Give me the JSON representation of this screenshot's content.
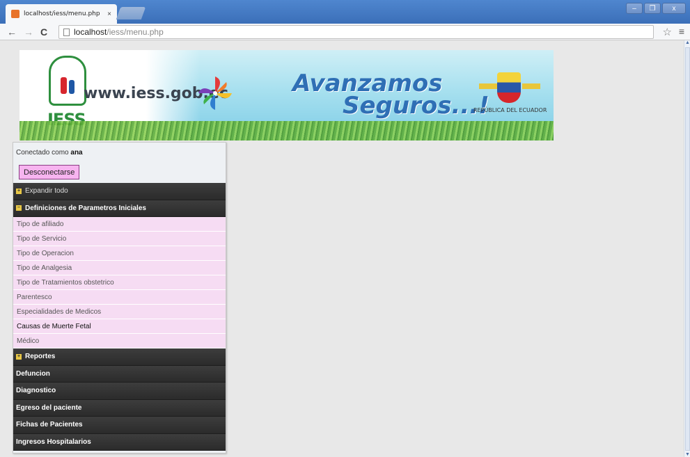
{
  "browser": {
    "tab_title": "localhost/iess/menu.php",
    "tab_close": "×",
    "url_host": "localhost",
    "url_path": "/iess/menu.php",
    "back": "←",
    "forward": "→",
    "reload": "C",
    "star": "☆",
    "menu": "≡",
    "minimize": "–",
    "maximize": "❐",
    "close": "x"
  },
  "banner": {
    "site": "www.iess.gob.ec",
    "logo_text": "IESS",
    "slogan_line1": "Avanzamos",
    "slogan_line2": "Seguros...!",
    "country": "REPÚBLICA DEL ECUADOR"
  },
  "session": {
    "connected_prefix": "Conectado como ",
    "user": "ana",
    "logout_label": "Desconectarse"
  },
  "menu": {
    "expand_all": "Expandir todo",
    "open_section": "Definiciones de Parametros Iniciales",
    "items": [
      "Tipo de afiliado",
      "Tipo de Servicio",
      "Tipo de Operacion",
      "Tipo de Analgesia",
      "Tipo de Tratamientos obstetrico",
      "Parentesco",
      "Especialidades de Medicos",
      "Causas de Muerte Fetal",
      "Médico"
    ],
    "reportes": "Reportes",
    "sections": [
      "Defuncion",
      "Diagnostico",
      "Egreso del paciente",
      "Fichas de Pacientes",
      "Ingresos Hospitalarios"
    ]
  },
  "icons": {
    "expand": "plus-box-icon",
    "collapse": "minus-box-icon"
  }
}
